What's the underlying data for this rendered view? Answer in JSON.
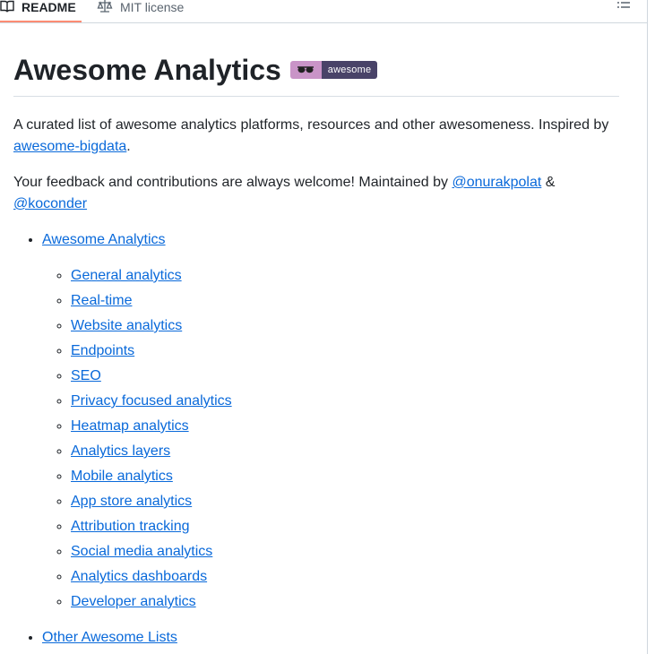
{
  "tabs": [
    {
      "label": "README",
      "icon": "book-icon",
      "active": true
    },
    {
      "label": "MIT license",
      "icon": "scale-icon",
      "active": false
    }
  ],
  "toc_icon": "list-unordered-icon",
  "readme": {
    "title": "Awesome Analytics",
    "badge": {
      "text": "awesome",
      "icon": "sunglasses-icon",
      "left_color": "#c994c7",
      "right_color": "#494368"
    },
    "intro_text": "A curated list of awesome analytics platforms, resources and other awesomeness. Inspired by ",
    "intro_link": "awesome-bigdata",
    "intro_end": ".",
    "feedback_text": "Your feedback and contributions are always welcome! Maintained by ",
    "maintainer1": "@onurakpolat",
    "amp": " & ",
    "maintainer2": "@koconder",
    "toc": {
      "main_link": "Awesome Analytics",
      "sub_links": [
        "General analytics",
        "Real-time",
        "Website analytics",
        "Endpoints",
        "SEO",
        "Privacy focused analytics",
        "Heatmap analytics",
        "Analytics layers",
        "Mobile analytics",
        "App store analytics",
        "Attribution tracking",
        "Social media analytics",
        "Analytics dashboards",
        "Developer analytics"
      ],
      "other_link": "Other Awesome Lists"
    }
  },
  "colors": {
    "link": "#0969da",
    "tab_underline": "#fd8c73",
    "text": "#1f2328",
    "border": "#d0d7de"
  }
}
